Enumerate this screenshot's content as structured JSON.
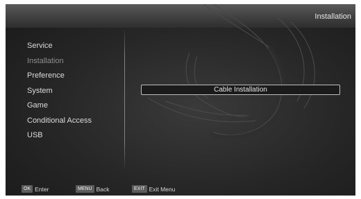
{
  "header": {
    "title": "Installation"
  },
  "menu": {
    "items": [
      {
        "label": "Service"
      },
      {
        "label": "Installation"
      },
      {
        "label": "Preference"
      },
      {
        "label": "System"
      },
      {
        "label": "Game"
      },
      {
        "label": "Conditional Access"
      },
      {
        "label": "USB"
      }
    ],
    "selected": "Installation"
  },
  "content": {
    "option_label": "Cable Installation"
  },
  "footer": {
    "hints": [
      {
        "key": "OK",
        "label": "Enter"
      },
      {
        "key": "MENU",
        "label": "Back"
      },
      {
        "key": "EXIT",
        "label": "Exit Menu"
      }
    ]
  }
}
